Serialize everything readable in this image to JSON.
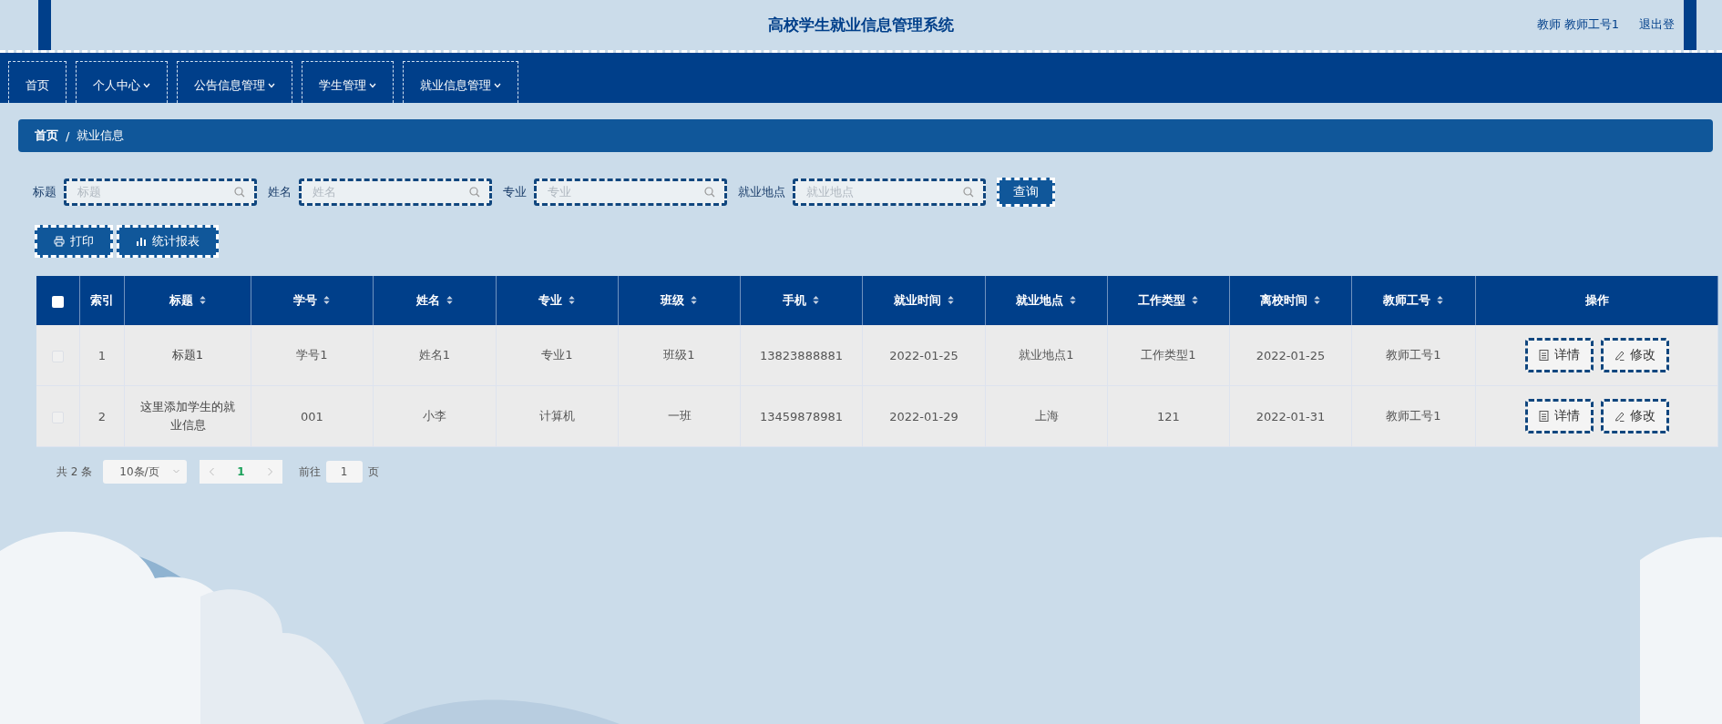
{
  "header": {
    "title": "高校学生就业信息管理系统",
    "user": "教师 教师工号1",
    "logout": "退出登"
  },
  "nav": [
    {
      "label": "首页",
      "dropdown": false
    },
    {
      "label": "个人中心",
      "dropdown": true
    },
    {
      "label": "公告信息管理",
      "dropdown": true
    },
    {
      "label": "学生管理",
      "dropdown": true
    },
    {
      "label": "就业信息管理",
      "dropdown": true
    }
  ],
  "breadcrumb": {
    "items": [
      "首页",
      "就业信息"
    ],
    "separator": "/"
  },
  "search": {
    "fields": [
      {
        "label": "标题",
        "placeholder": "标题"
      },
      {
        "label": "姓名",
        "placeholder": "姓名"
      },
      {
        "label": "专业",
        "placeholder": "专业"
      },
      {
        "label": "就业地点",
        "placeholder": "就业地点"
      }
    ],
    "button": "查询"
  },
  "toolbar": [
    {
      "kind": "print",
      "label": "打印"
    },
    {
      "kind": "chart",
      "label": "统计报表"
    }
  ],
  "table": {
    "select_all_checked": false,
    "columns": [
      {
        "label": "索引",
        "sortable": false
      },
      {
        "label": "标题",
        "sortable": true
      },
      {
        "label": "学号",
        "sortable": true
      },
      {
        "label": "姓名",
        "sortable": true
      },
      {
        "label": "专业",
        "sortable": true
      },
      {
        "label": "班级",
        "sortable": true
      },
      {
        "label": "手机",
        "sortable": true
      },
      {
        "label": "就业时间",
        "sortable": true
      },
      {
        "label": "就业地点",
        "sortable": true
      },
      {
        "label": "工作类型",
        "sortable": true
      },
      {
        "label": "离校时间",
        "sortable": true
      },
      {
        "label": "教师工号",
        "sortable": true
      },
      {
        "label": "操作",
        "sortable": false
      }
    ],
    "rows": [
      {
        "checked": false,
        "cells": [
          "1",
          "标题1",
          "学号1",
          "姓名1",
          "专业1",
          "班级1",
          "13823888881",
          "2022-01-25",
          "就业地点1",
          "工作类型1",
          "2022-01-25",
          "教师工号1"
        ],
        "actions": [
          {
            "kind": "detail",
            "label": "详情"
          },
          {
            "kind": "edit",
            "label": "修改"
          }
        ]
      },
      {
        "checked": false,
        "cells": [
          "2",
          "这里添加学生的就业信息",
          "001",
          "小李",
          "计算机",
          "一班",
          "13459878981",
          "2022-01-29",
          "上海",
          "121",
          "2022-01-31",
          "教师工号1"
        ],
        "actions": [
          {
            "kind": "detail",
            "label": "详情"
          },
          {
            "kind": "edit",
            "label": "修改"
          }
        ]
      }
    ]
  },
  "pagination": {
    "total": "共 2 条",
    "page_size": "10条/页",
    "current": "1",
    "goto_label": "前往",
    "goto_value": "1",
    "page_unit": "页"
  }
}
